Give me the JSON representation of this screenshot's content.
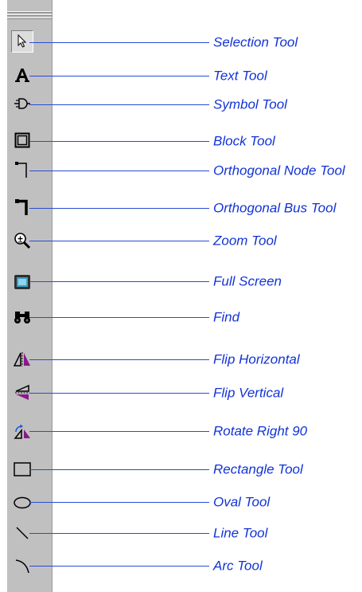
{
  "colors": {
    "toolbar_bg": "#c0c0c0",
    "callout": "#1233d6"
  },
  "tools": [
    {
      "icon": "selection-arrow-icon",
      "label": "Selection Tool"
    },
    {
      "icon": "text-a-icon",
      "label": "Text Tool"
    },
    {
      "icon": "symbol-plug-icon",
      "label": "Symbol Tool"
    },
    {
      "icon": "block-square-icon",
      "label": "Block Tool"
    },
    {
      "icon": "orthogonal-node-icon",
      "label": "Orthogonal Node Tool"
    },
    {
      "icon": "orthogonal-bus-icon",
      "label": "Orthogonal Bus Tool"
    },
    {
      "icon": "zoom-magnifier-icon",
      "label": "Zoom Tool"
    },
    {
      "icon": "full-screen-icon",
      "label": "Full Screen"
    },
    {
      "icon": "binoculars-icon",
      "label": "Find"
    },
    {
      "icon": "flip-horizontal-icon",
      "label": "Flip Horizontal"
    },
    {
      "icon": "flip-vertical-icon",
      "label": "Flip Vertical"
    },
    {
      "icon": "rotate-right-icon",
      "label": "Rotate Right 90"
    },
    {
      "icon": "rectangle-icon",
      "label": "Rectangle Tool"
    },
    {
      "icon": "oval-icon",
      "label": "Oval Tool"
    },
    {
      "icon": "line-icon",
      "label": "Line Tool"
    },
    {
      "icon": "arc-icon",
      "label": "Arc Tool"
    }
  ]
}
